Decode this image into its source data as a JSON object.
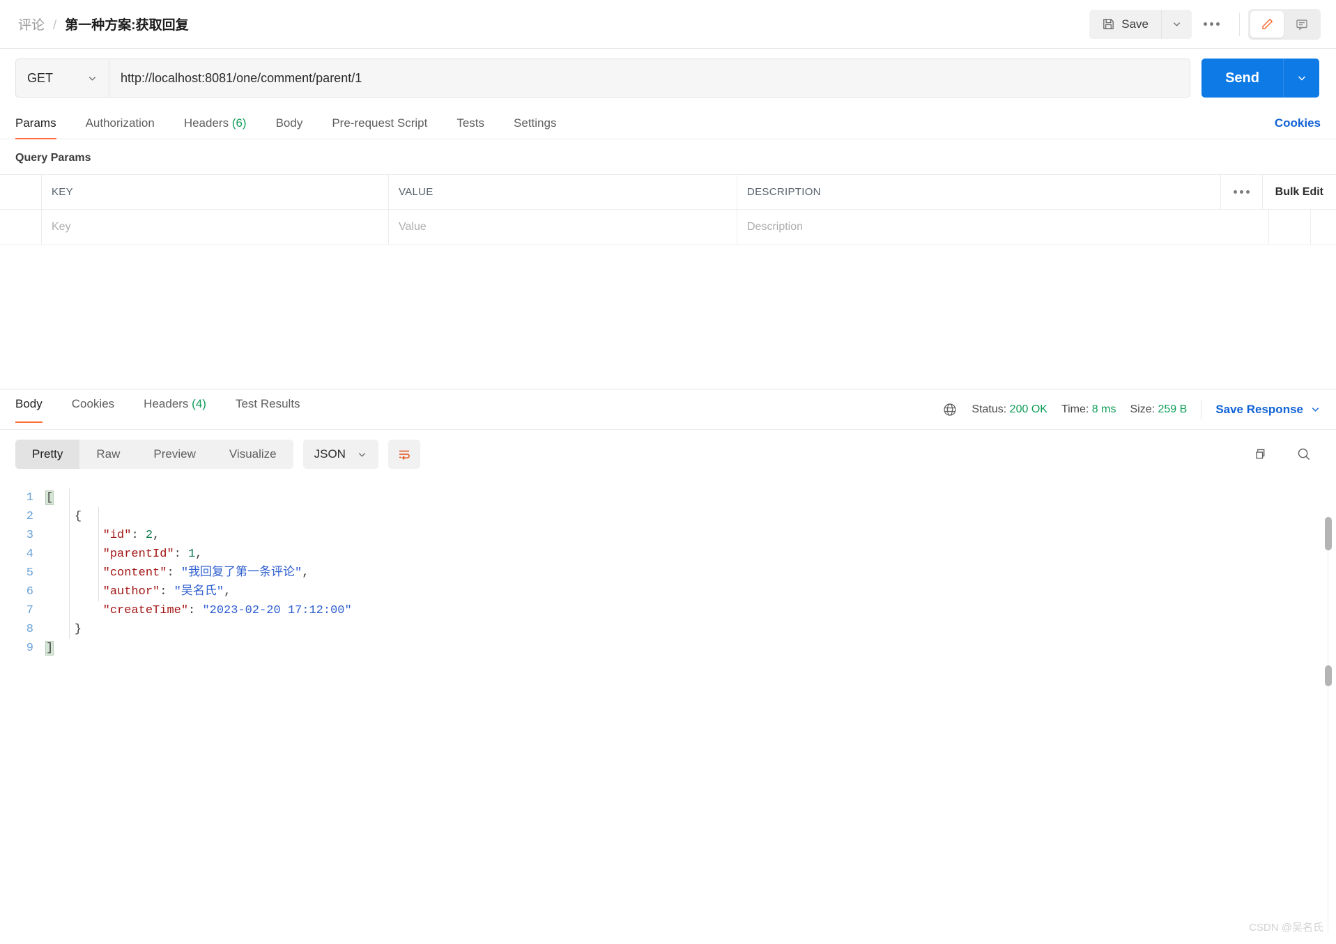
{
  "header": {
    "breadcrumb_root": "评论",
    "breadcrumb_separator": "/",
    "breadcrumb_leaf": "第一种方案:获取回复",
    "save_label": "Save",
    "accent_color": "#ff6c37",
    "link_color": "#1062d6",
    "send_color": "#0d7ae5"
  },
  "request": {
    "method": "GET",
    "url": "http://localhost:8081/one/comment/parent/1",
    "send_label": "Send",
    "tabs": [
      {
        "label": "Params",
        "count": "",
        "active": true
      },
      {
        "label": "Authorization",
        "count": "",
        "active": false
      },
      {
        "label": "Headers",
        "count": "(6)",
        "active": false
      },
      {
        "label": "Body",
        "count": "",
        "active": false
      },
      {
        "label": "Pre-request Script",
        "count": "",
        "active": false
      },
      {
        "label": "Tests",
        "count": "",
        "active": false
      },
      {
        "label": "Settings",
        "count": "",
        "active": false
      }
    ],
    "cookies_link": "Cookies"
  },
  "params": {
    "section_title": "Query Params",
    "columns": [
      "KEY",
      "VALUE",
      "DESCRIPTION"
    ],
    "bulk_edit_label": "Bulk Edit",
    "empty_row": {
      "key_placeholder": "Key",
      "value_placeholder": "Value",
      "description_placeholder": "Description"
    }
  },
  "response": {
    "tabs": [
      {
        "label": "Body",
        "count": "",
        "active": true
      },
      {
        "label": "Cookies",
        "count": "",
        "active": false
      },
      {
        "label": "Headers",
        "count": "(4)",
        "active": false
      },
      {
        "label": "Test Results",
        "count": "",
        "active": false
      }
    ],
    "status_label": "Status:",
    "status_value": "200 OK",
    "time_label": "Time:",
    "time_value": "8 ms",
    "size_label": "Size:",
    "size_value": "259 B",
    "save_response_label": "Save Response",
    "view_modes": [
      {
        "label": "Pretty",
        "active": true
      },
      {
        "label": "Raw",
        "active": false
      },
      {
        "label": "Preview",
        "active": false
      },
      {
        "label": "Visualize",
        "active": false
      }
    ],
    "format": "JSON",
    "body_lines": [
      {
        "num": "1",
        "indent": 0,
        "tokens": [
          {
            "t": "[",
            "c": "p",
            "hl": true
          }
        ]
      },
      {
        "num": "2",
        "indent": 1,
        "tokens": [
          {
            "t": "{",
            "c": "p"
          }
        ]
      },
      {
        "num": "3",
        "indent": 2,
        "tokens": [
          {
            "t": "\"id\"",
            "c": "k"
          },
          {
            "t": ": ",
            "c": "p"
          },
          {
            "t": "2",
            "c": "n"
          },
          {
            "t": ",",
            "c": "p"
          }
        ]
      },
      {
        "num": "4",
        "indent": 2,
        "tokens": [
          {
            "t": "\"parentId\"",
            "c": "k"
          },
          {
            "t": ": ",
            "c": "p"
          },
          {
            "t": "1",
            "c": "n"
          },
          {
            "t": ",",
            "c": "p"
          }
        ]
      },
      {
        "num": "5",
        "indent": 2,
        "tokens": [
          {
            "t": "\"content\"",
            "c": "k"
          },
          {
            "t": ": ",
            "c": "p"
          },
          {
            "t": "\"我回复了第一条评论\"",
            "c": "s"
          },
          {
            "t": ",",
            "c": "p"
          }
        ]
      },
      {
        "num": "6",
        "indent": 2,
        "tokens": [
          {
            "t": "\"author\"",
            "c": "k"
          },
          {
            "t": ": ",
            "c": "p"
          },
          {
            "t": "\"吴名氏\"",
            "c": "s"
          },
          {
            "t": ",",
            "c": "p"
          }
        ]
      },
      {
        "num": "7",
        "indent": 2,
        "tokens": [
          {
            "t": "\"createTime\"",
            "c": "k"
          },
          {
            "t": ": ",
            "c": "p"
          },
          {
            "t": "\"2023-02-20 17:12:00\"",
            "c": "s"
          }
        ]
      },
      {
        "num": "8",
        "indent": 1,
        "tokens": [
          {
            "t": "}",
            "c": "p"
          }
        ]
      },
      {
        "num": "9",
        "indent": 0,
        "tokens": [
          {
            "t": "]",
            "c": "p",
            "hl": true
          }
        ]
      }
    ]
  },
  "watermark": "CSDN @吴名氏",
  "icons": {
    "save": "floppy-disk-icon",
    "caret": "chevron-down-icon",
    "more": "three-dots-icon",
    "edit": "pencil-icon",
    "comment": "comment-icon",
    "globe": "globe-icon",
    "copy": "copy-icon",
    "search": "search-icon",
    "wrap": "word-wrap-icon"
  }
}
